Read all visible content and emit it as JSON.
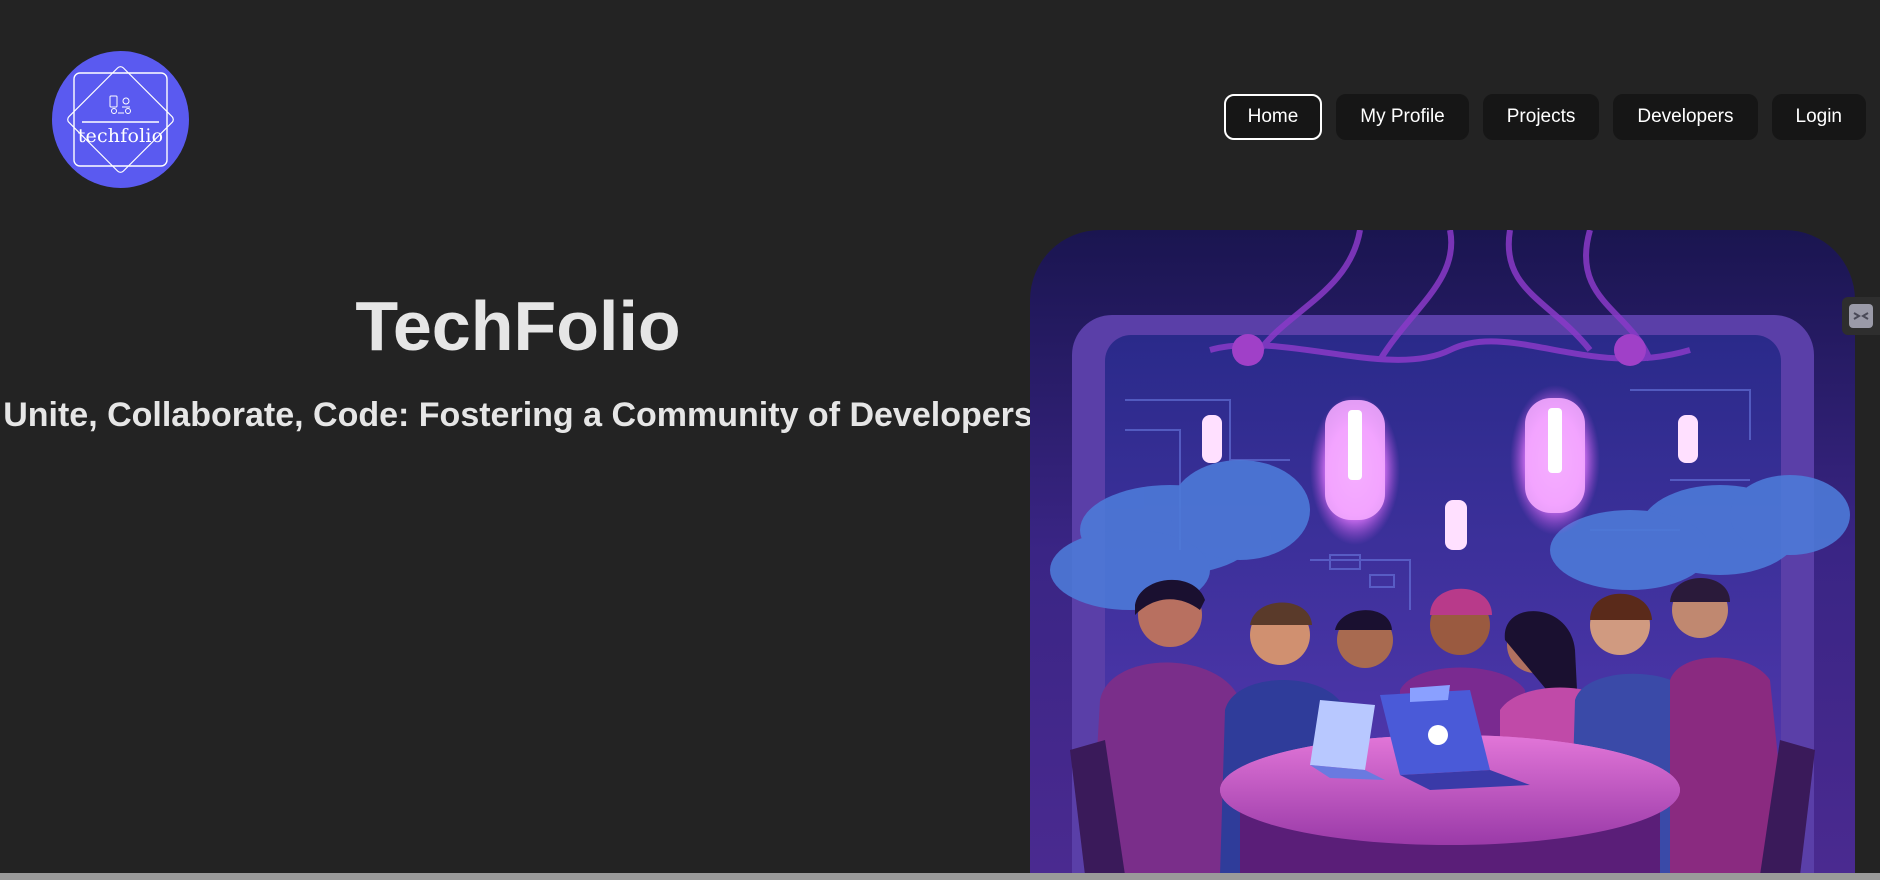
{
  "brand": {
    "logo_text": "techfolio",
    "accent": "#5a5af0"
  },
  "nav": {
    "items": [
      {
        "label": "Home",
        "active": true
      },
      {
        "label": "My Profile",
        "active": false
      },
      {
        "label": "Projects",
        "active": false
      },
      {
        "label": "Developers",
        "active": false
      },
      {
        "label": "Login",
        "active": false
      }
    ]
  },
  "hero": {
    "title": "TechFolio",
    "subtitle": "Unite, Collaborate, Code: Fostering a Community of Developers",
    "image_icon": "developers-collaborating-illustration"
  },
  "colors": {
    "background": "#232323",
    "text": "#e6e6e6",
    "nav_button": "#161616",
    "image_purple": "#6a35c8"
  }
}
